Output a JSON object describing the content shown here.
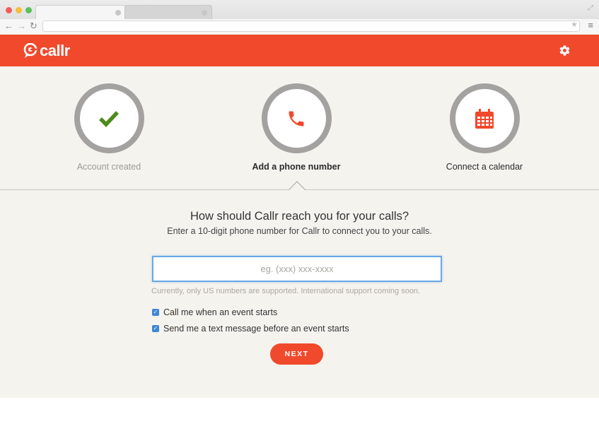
{
  "browser": {
    "nav": {
      "back_icon": "arrow-left-icon",
      "forward_icon": "arrow-right-icon",
      "reload_icon": "reload-icon"
    },
    "address_value": "",
    "icons": [
      "star-icon",
      "menu-icon",
      "resize-icon"
    ]
  },
  "header": {
    "logo_text": "callr",
    "settings_icon": "gear-icon",
    "brand_color": "#f0492c"
  },
  "steps": [
    {
      "label": "Account created",
      "icon": "checkmark-icon",
      "state": "completed",
      "icon_color": "#4f8a1e"
    },
    {
      "label": "Add a phone number",
      "icon": "phone-icon",
      "state": "current",
      "icon_color": "#f0492c"
    },
    {
      "label": "Connect a calendar",
      "icon": "calendar-icon",
      "state": "upcoming",
      "icon_color": "#f0492c"
    }
  ],
  "form": {
    "question": "How should Callr reach you for your calls?",
    "subtext": "Enter a 10-digit phone number for Callr to connect you to your calls.",
    "phone_placeholder": "eg. (xxx) xxx-xxxx",
    "phone_value": "",
    "note": "Currently, only US numbers are supported. International support coming soon.",
    "checkboxes": [
      {
        "label": "Call me when an event starts",
        "checked": true
      },
      {
        "label": "Send me a text message before an event starts",
        "checked": true
      }
    ],
    "next_label": "NEXT"
  }
}
